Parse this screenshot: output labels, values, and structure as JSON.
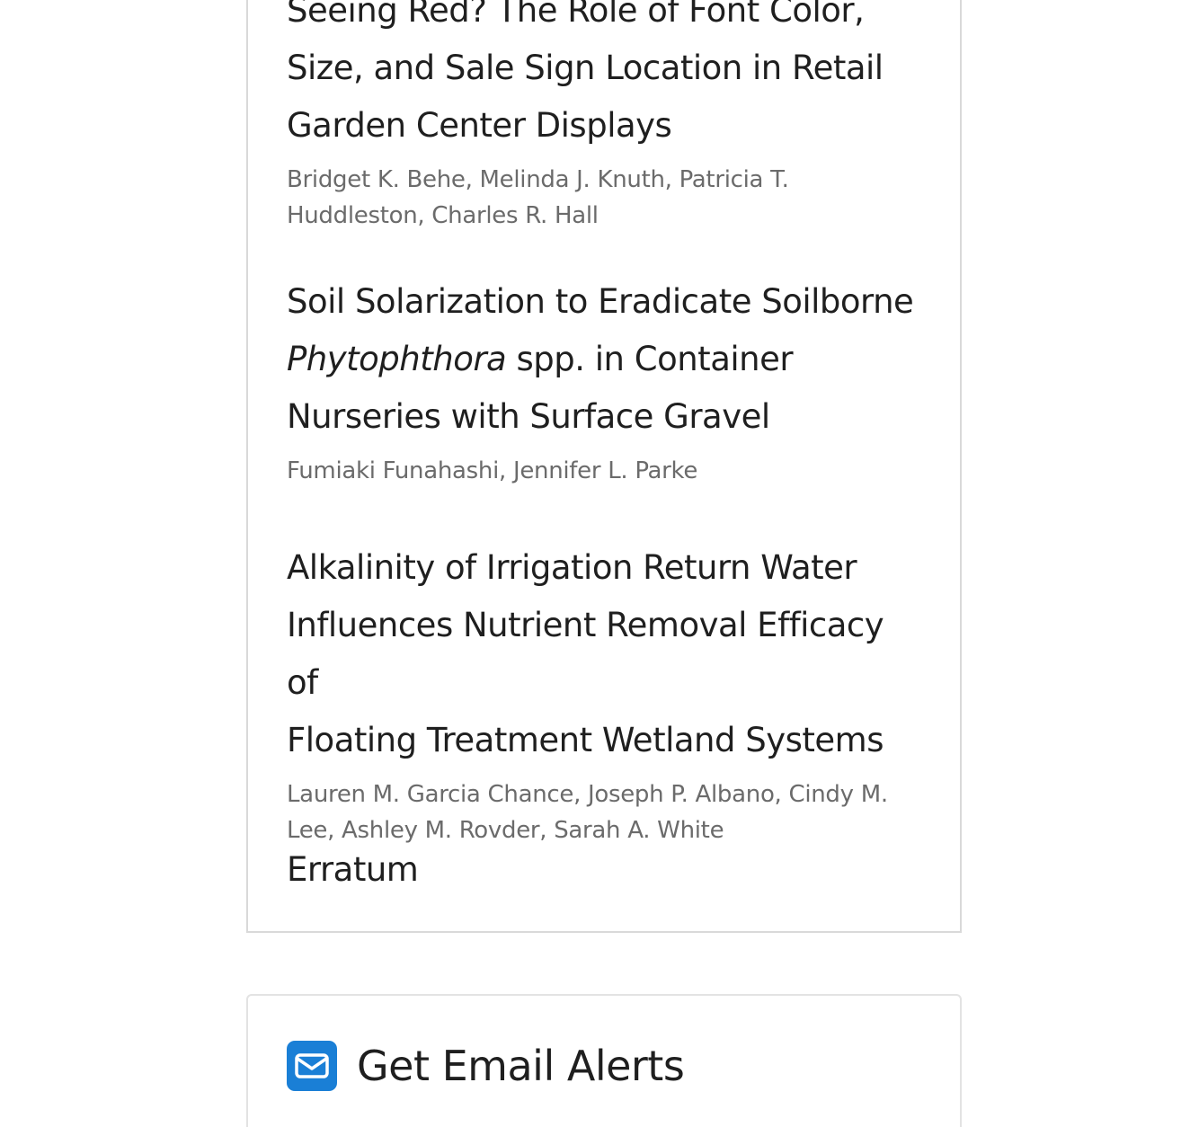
{
  "articles": [
    {
      "title_lines": [
        "Seeing Red? The Role of Font Color,",
        "Size, and Sale Sign Location in Retail",
        "Garden Center Displays"
      ],
      "authors": "Bridget K. Behe, Melinda J. Knuth, Patricia T. Huddleston, Charles R. Hall"
    },
    {
      "title_line1": "Soil Solarization to Eradicate Soilborne",
      "title_italic": "Phytophthora",
      "title_line2_rest": " spp. in Container",
      "title_line3": "Nurseries with Surface Gravel",
      "authors": "Fumiaki Funahashi, Jennifer L. Parke"
    },
    {
      "title_lines": [
        "Alkalinity of Irrigation Return Water",
        "Influences Nutrient Removal Efficacy of",
        "Floating Treatment Wetland Systems"
      ],
      "authors": "Lauren M. Garcia Chance, Joseph P. Albano, Cindy M. Lee, Ashley M. Rovder, Sarah A. White"
    },
    {
      "title": "Erratum"
    }
  ],
  "email_alerts": {
    "title": "Get Email Alerts",
    "icon": "envelope-icon",
    "icon_color": "#1a7fd6"
  }
}
